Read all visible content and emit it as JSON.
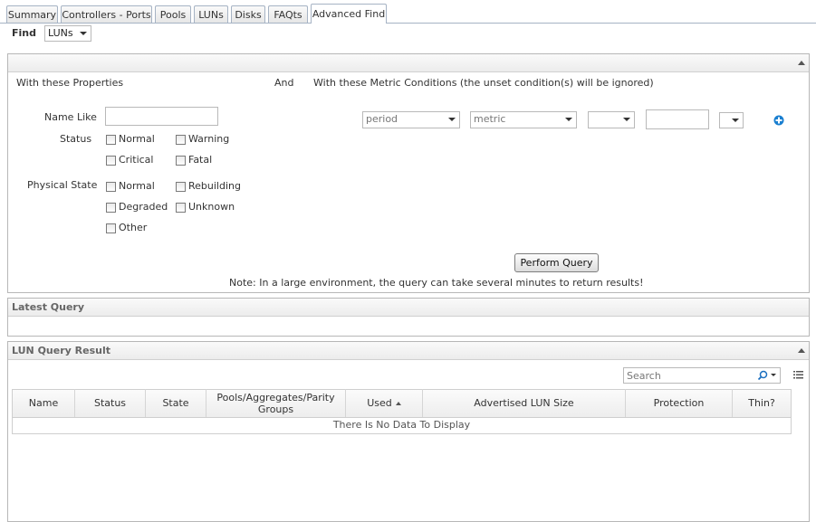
{
  "tabs": [
    {
      "label": "Summary"
    },
    {
      "label": "Controllers - Ports"
    },
    {
      "label": "Pools"
    },
    {
      "label": "LUNs"
    },
    {
      "label": "Disks"
    },
    {
      "label": "FAQts"
    },
    {
      "label": "Advanced Find"
    }
  ],
  "find": {
    "label": "Find",
    "selected": "LUNs"
  },
  "properties": {
    "header": "With these Properties",
    "and_label": "And",
    "metric_header": "With these Metric Conditions (the unset condition(s) will be ignored)",
    "name_like_label": "Name Like",
    "name_like_value": "",
    "status_label": "Status",
    "status_options": [
      "Normal",
      "Warning",
      "Critical",
      "Fatal"
    ],
    "physical_state_label": "Physical State",
    "physical_options": [
      "Normal",
      "Rebuilding",
      "Degraded",
      "Unknown",
      "Other"
    ]
  },
  "metric": {
    "period_placeholder": "period",
    "metric_placeholder": "metric",
    "operator_value": "",
    "value": "",
    "unit_value": ""
  },
  "query": {
    "button_label": "Perform Query",
    "note": "Note: In a large environment, the query can take several minutes to return results!"
  },
  "latest_query": {
    "title": "Latest Query"
  },
  "result": {
    "title": "LUN Query Result",
    "search_placeholder": "Search",
    "columns": [
      "Name",
      "Status",
      "State",
      "Pools/Aggregates/Parity Groups",
      "Used",
      "Advertised LUN Size",
      "Protection",
      "Thin?"
    ],
    "empty_text": "There Is No Data To Display"
  }
}
